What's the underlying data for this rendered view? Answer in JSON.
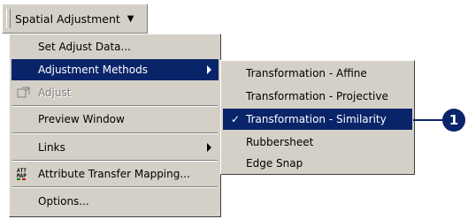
{
  "toolbar": {
    "label": "Spatial Adjustment",
    "dropdown_arrow": "▼"
  },
  "menu": {
    "items": [
      {
        "label": "Set Adjust Data...",
        "icon": ""
      },
      {
        "label": "Adjustment Methods",
        "icon": "",
        "submenu": true,
        "highlighted": true
      },
      {
        "label": "Adjust",
        "icon": "adjust-icon",
        "disabled": true
      },
      {
        "label": "Preview Window",
        "icon": ""
      },
      {
        "label": "Links",
        "icon": "",
        "submenu": true
      },
      {
        "label": "Attribute Transfer Mapping...",
        "icon": "attribute-transfer-icon",
        "icon_text": "ATT\nMAP"
      },
      {
        "label": "Options...",
        "icon": ""
      }
    ]
  },
  "submenu": {
    "items": [
      {
        "label": "Transformation - Affine"
      },
      {
        "label": "Transformation - Projective"
      },
      {
        "label": "Transformation - Similarity",
        "checked": true,
        "highlighted": true,
        "check_mark": "✓"
      },
      {
        "label": "Rubbersheet"
      },
      {
        "label": "Edge Snap"
      }
    ]
  },
  "callout": {
    "number": "1"
  },
  "colors": {
    "highlight": "#0a246a",
    "menu_bg": "#d4d0c8",
    "disabled_text": "#808080"
  }
}
